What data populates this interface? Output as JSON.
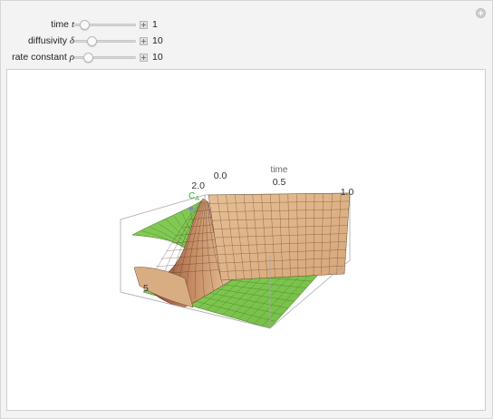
{
  "controls": [
    {
      "label": "time",
      "symbol": "t",
      "value": "1",
      "position": 0.1
    },
    {
      "label": "diffusivity",
      "symbol": "δ",
      "value": "10",
      "position": 0.25
    },
    {
      "label": "rate constant",
      "symbol": "ρ",
      "value": "10",
      "position": 0.18
    }
  ],
  "plot": {
    "axis_title": "time",
    "time_ticks": [
      "0.0",
      "0.5",
      "1.0"
    ],
    "left_tick": "2.0",
    "species_label": "C",
    "species_subscript": "A",
    "lower_left_tick": "5",
    "colors": {
      "tan_surface": "#d9a87a",
      "tan_light": "#eac9a3",
      "dark_red_brown": "#7b3a2c",
      "green_surface": "#7fc650",
      "green_label": "#2db52d",
      "box_edge": "#9a9a9a",
      "mesh_line": "#5a4a3a"
    }
  }
}
